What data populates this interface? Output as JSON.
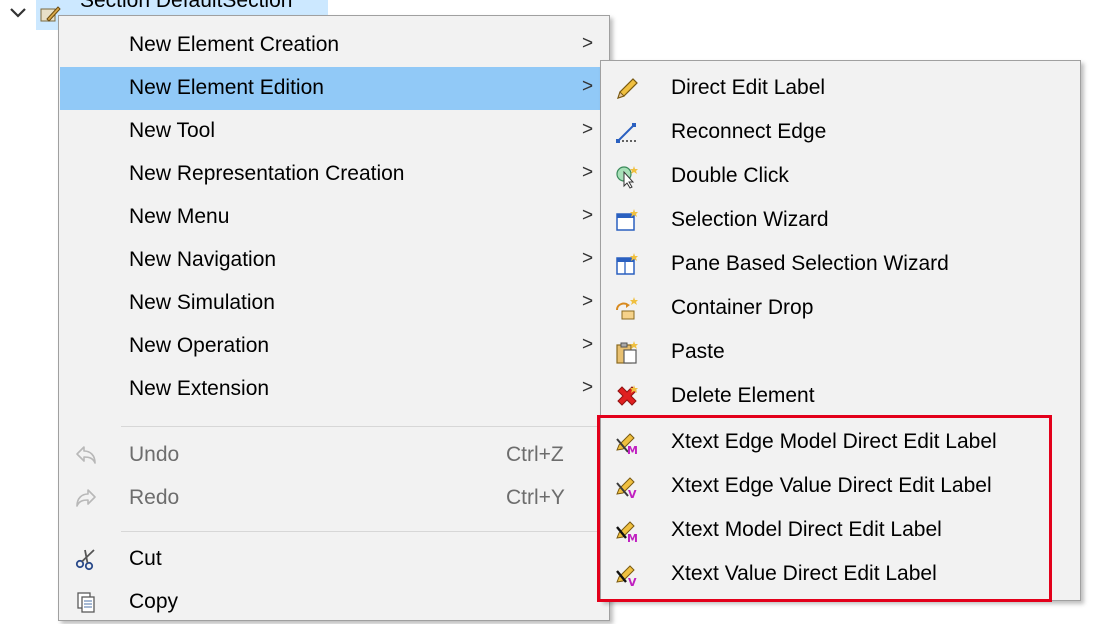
{
  "tree": {
    "node_label": "Section DefaultSection"
  },
  "menu": {
    "items": [
      {
        "label": "New Element Creation",
        "arrow": ">"
      },
      {
        "label": "New Element Edition",
        "arrow": ">"
      },
      {
        "label": "New Tool",
        "arrow": ">"
      },
      {
        "label": "New Representation Creation",
        "arrow": ">"
      },
      {
        "label": "New Menu",
        "arrow": ">"
      },
      {
        "label": "New Navigation",
        "arrow": ">"
      },
      {
        "label": "New Simulation",
        "arrow": ">"
      },
      {
        "label": "New Operation",
        "arrow": ">"
      },
      {
        "label": "New Extension",
        "arrow": ">"
      }
    ],
    "undo": {
      "label": "Undo",
      "shortcut": "Ctrl+Z",
      "icon": "undo-icon"
    },
    "redo": {
      "label": "Redo",
      "shortcut": "Ctrl+Y",
      "icon": "redo-icon"
    },
    "cut": {
      "label": "Cut",
      "icon": "scissors-icon"
    },
    "copy": {
      "label": "Copy",
      "icon": "copy-icon"
    },
    "highlight_color": "#91c9f7"
  },
  "submenu": {
    "items": [
      {
        "label": "Direct Edit Label",
        "icon": "pencil-icon"
      },
      {
        "label": "Reconnect Edge",
        "icon": "reconnect-edge-icon"
      },
      {
        "label": "Double Click",
        "icon": "double-click-icon"
      },
      {
        "label": "Selection Wizard",
        "icon": "selection-wizard-icon"
      },
      {
        "label": "Pane Based Selection Wizard",
        "icon": "pane-wizard-icon"
      },
      {
        "label": "Container Drop",
        "icon": "container-drop-icon"
      },
      {
        "label": "Paste",
        "icon": "paste-icon"
      },
      {
        "label": "Delete Element",
        "icon": "delete-icon"
      },
      {
        "label": "Xtext Edge Model Direct Edit Label",
        "icon": "xtext-edge-model-icon"
      },
      {
        "label": "Xtext Edge Value Direct Edit Label",
        "icon": "xtext-edge-value-icon"
      },
      {
        "label": "Xtext Model Direct Edit Label",
        "icon": "xtext-model-icon"
      },
      {
        "label": "Xtext Value Direct Edit Label",
        "icon": "xtext-value-icon"
      }
    ],
    "highlight_box_color": "#e3001b"
  }
}
